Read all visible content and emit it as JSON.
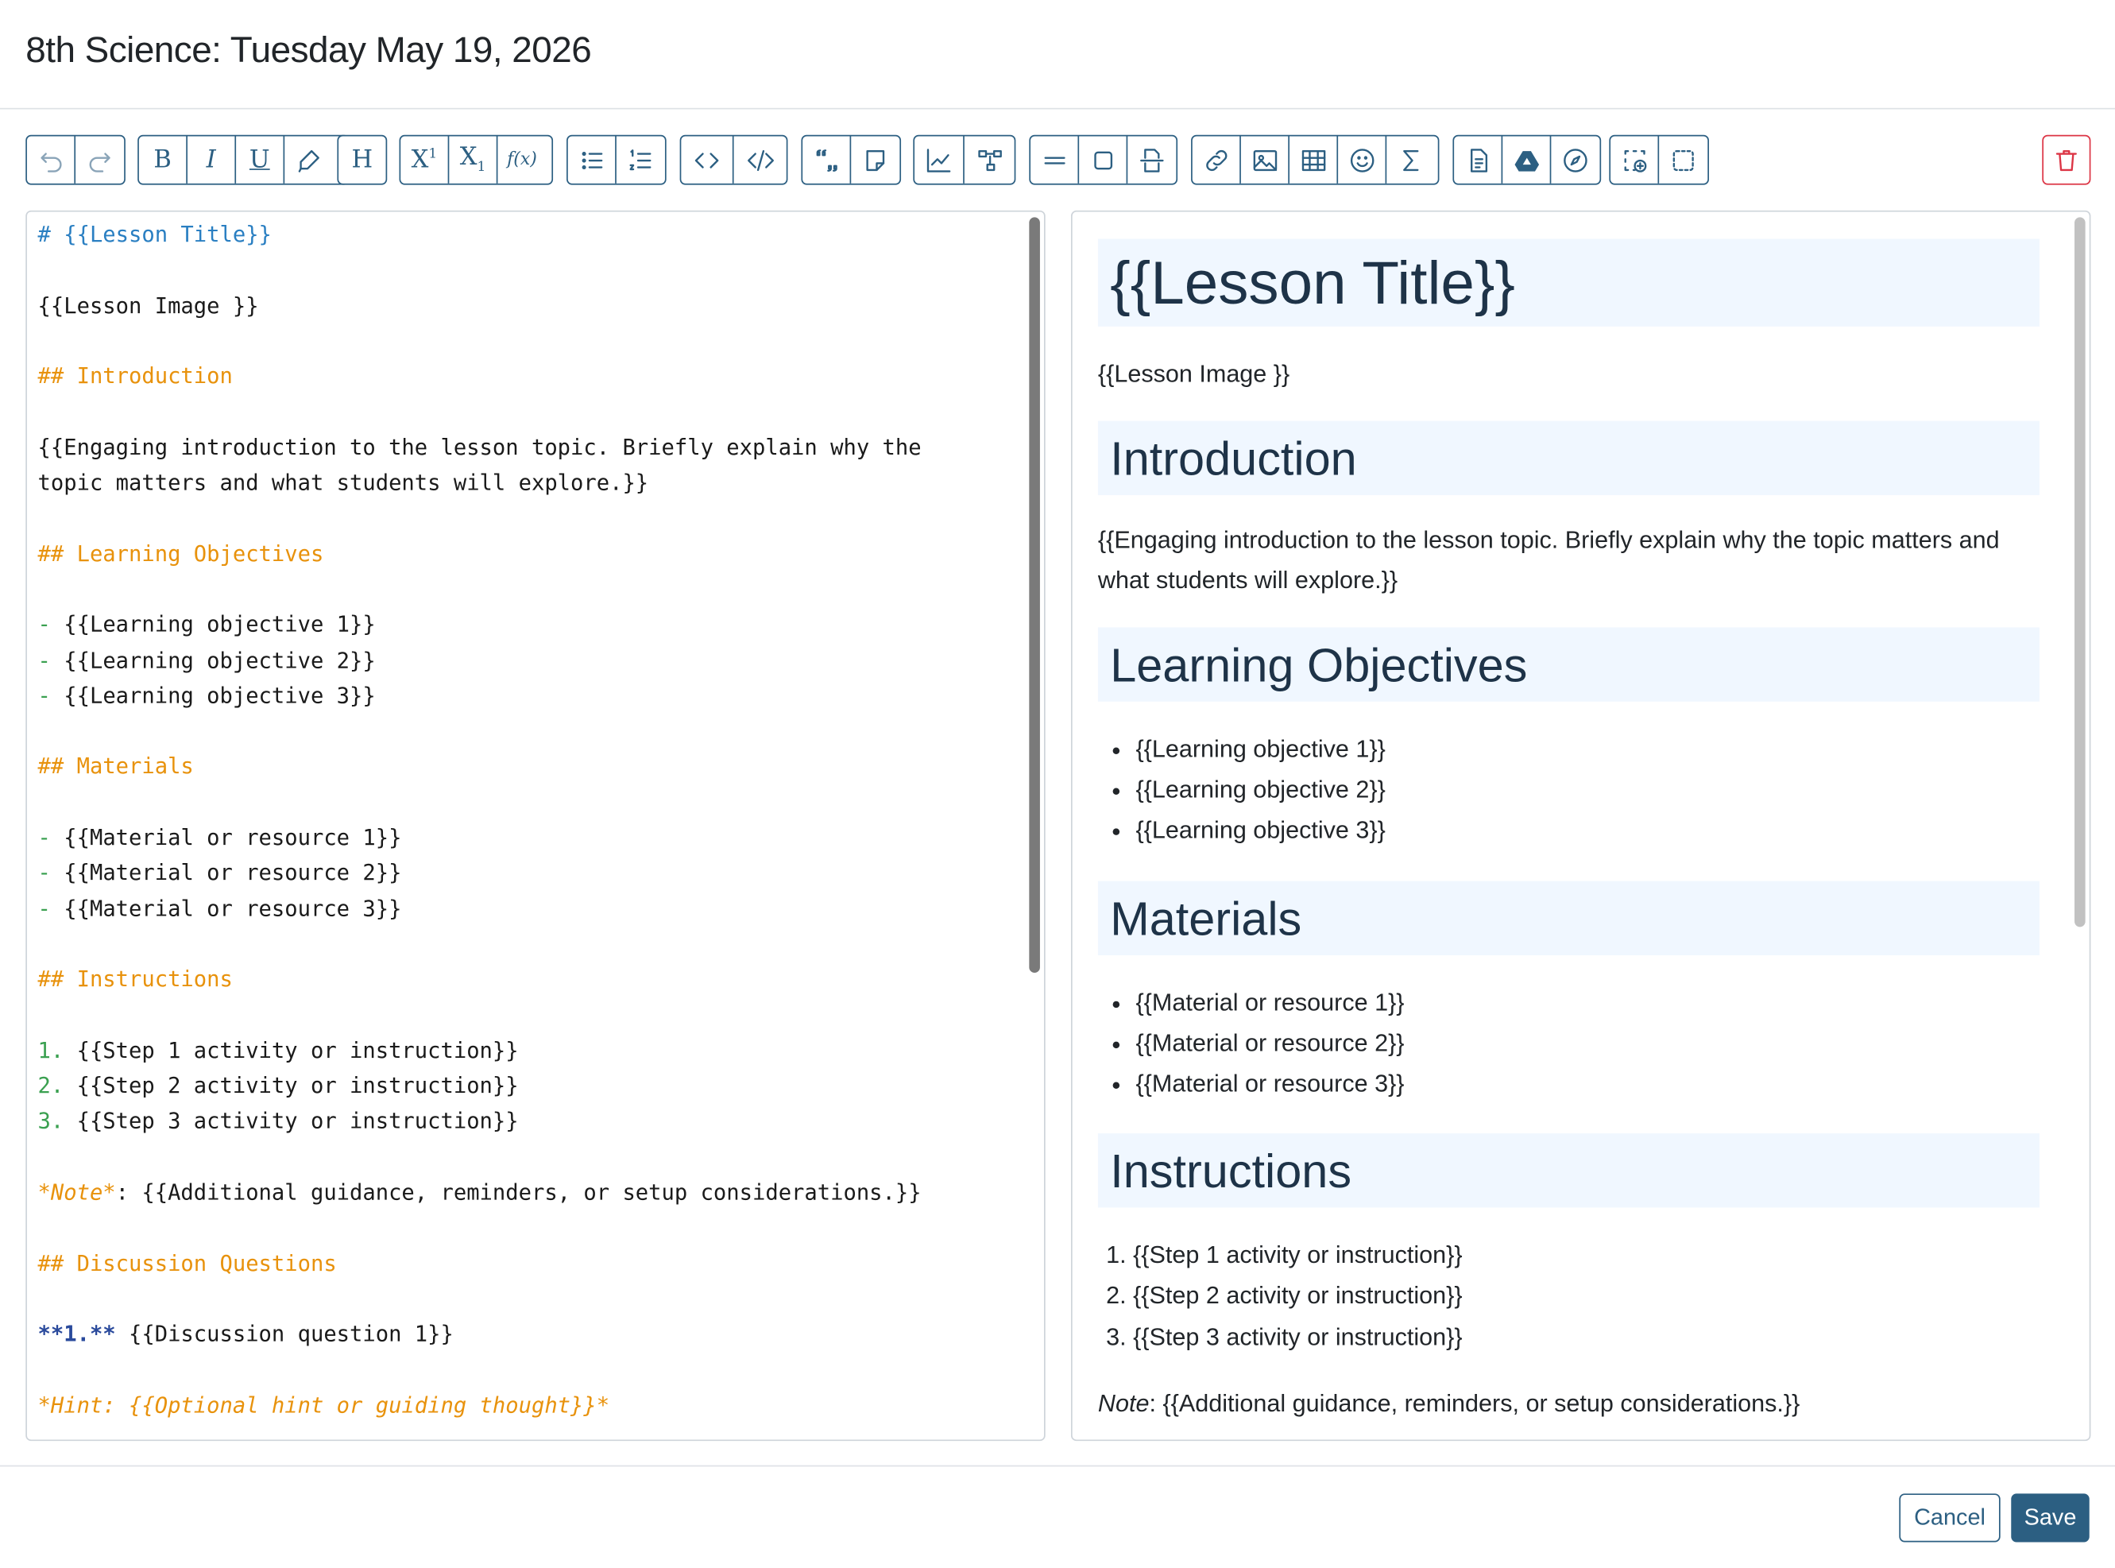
{
  "header": {
    "title": "8th Science: Tuesday May 19, 2026"
  },
  "toolbar": {
    "bold_label": "B",
    "italic_label": "I",
    "underline_label": "U",
    "heading_label": "H",
    "superscript_label": "X",
    "superscript_mark": "1",
    "subscript_label": "X",
    "subscript_mark": "1",
    "function_label": "f(x)"
  },
  "editor": {
    "lines": [
      "# {{Lesson Title}}",
      "",
      "{{Lesson Image }}",
      "",
      "## Introduction",
      "",
      "{{Engaging introduction to the lesson topic. Briefly explain why the",
      "topic matters and what students will explore.}}",
      "",
      "## Learning Objectives",
      "",
      "- {{Learning objective 1}}",
      "- {{Learning objective 2}}",
      "- {{Learning objective 3}}",
      "",
      "## Materials",
      "",
      "- {{Material or resource 1}}",
      "- {{Material or resource 2}}",
      "- {{Material or resource 3}}",
      "",
      "## Instructions",
      "",
      "1. {{Step 1 activity or instruction}}",
      "2. {{Step 2 activity or instruction}}",
      "3. {{Step 3 activity or instruction}}",
      "",
      "*Note*: {{Additional guidance, reminders, or setup considerations.}}",
      "",
      "## Discussion Questions",
      "",
      "**1.** {{Discussion question 1}}",
      "",
      "*Hint: {{Optional hint or guiding thought}}*"
    ]
  },
  "preview": {
    "title": "{{Lesson Title}}",
    "image_placeholder": "{{Lesson Image }}",
    "intro_heading": "Introduction",
    "intro_text": "{{Engaging introduction to the lesson topic. Briefly explain why the topic matters and what students will explore.}}",
    "objectives_heading": "Learning Objectives",
    "objectives": [
      "{{Learning objective 1}}",
      "{{Learning objective 2}}",
      "{{Learning objective 3}}"
    ],
    "materials_heading": "Materials",
    "materials": [
      "{{Material or resource 1}}",
      "{{Material or resource 2}}",
      "{{Material or resource 3}}"
    ],
    "instructions_heading": "Instructions",
    "instructions": [
      "{{Step 1 activity or instruction}}",
      "{{Step 2 activity or instruction}}",
      "{{Step 3 activity or instruction}}"
    ],
    "note_label": "Note",
    "note_text": ": {{Additional guidance, reminders, or setup considerations.}}"
  },
  "footer": {
    "cancel_label": "Cancel",
    "save_label": "Save"
  },
  "colors": {
    "primary": "#2c5f82",
    "danger": "#dc3545",
    "heading_bg": "#f0f7ff",
    "md_h1": "#2a7fc2",
    "md_h2": "#e8920c",
    "md_list": "#3aa050",
    "md_strong": "#2a4a9c"
  }
}
